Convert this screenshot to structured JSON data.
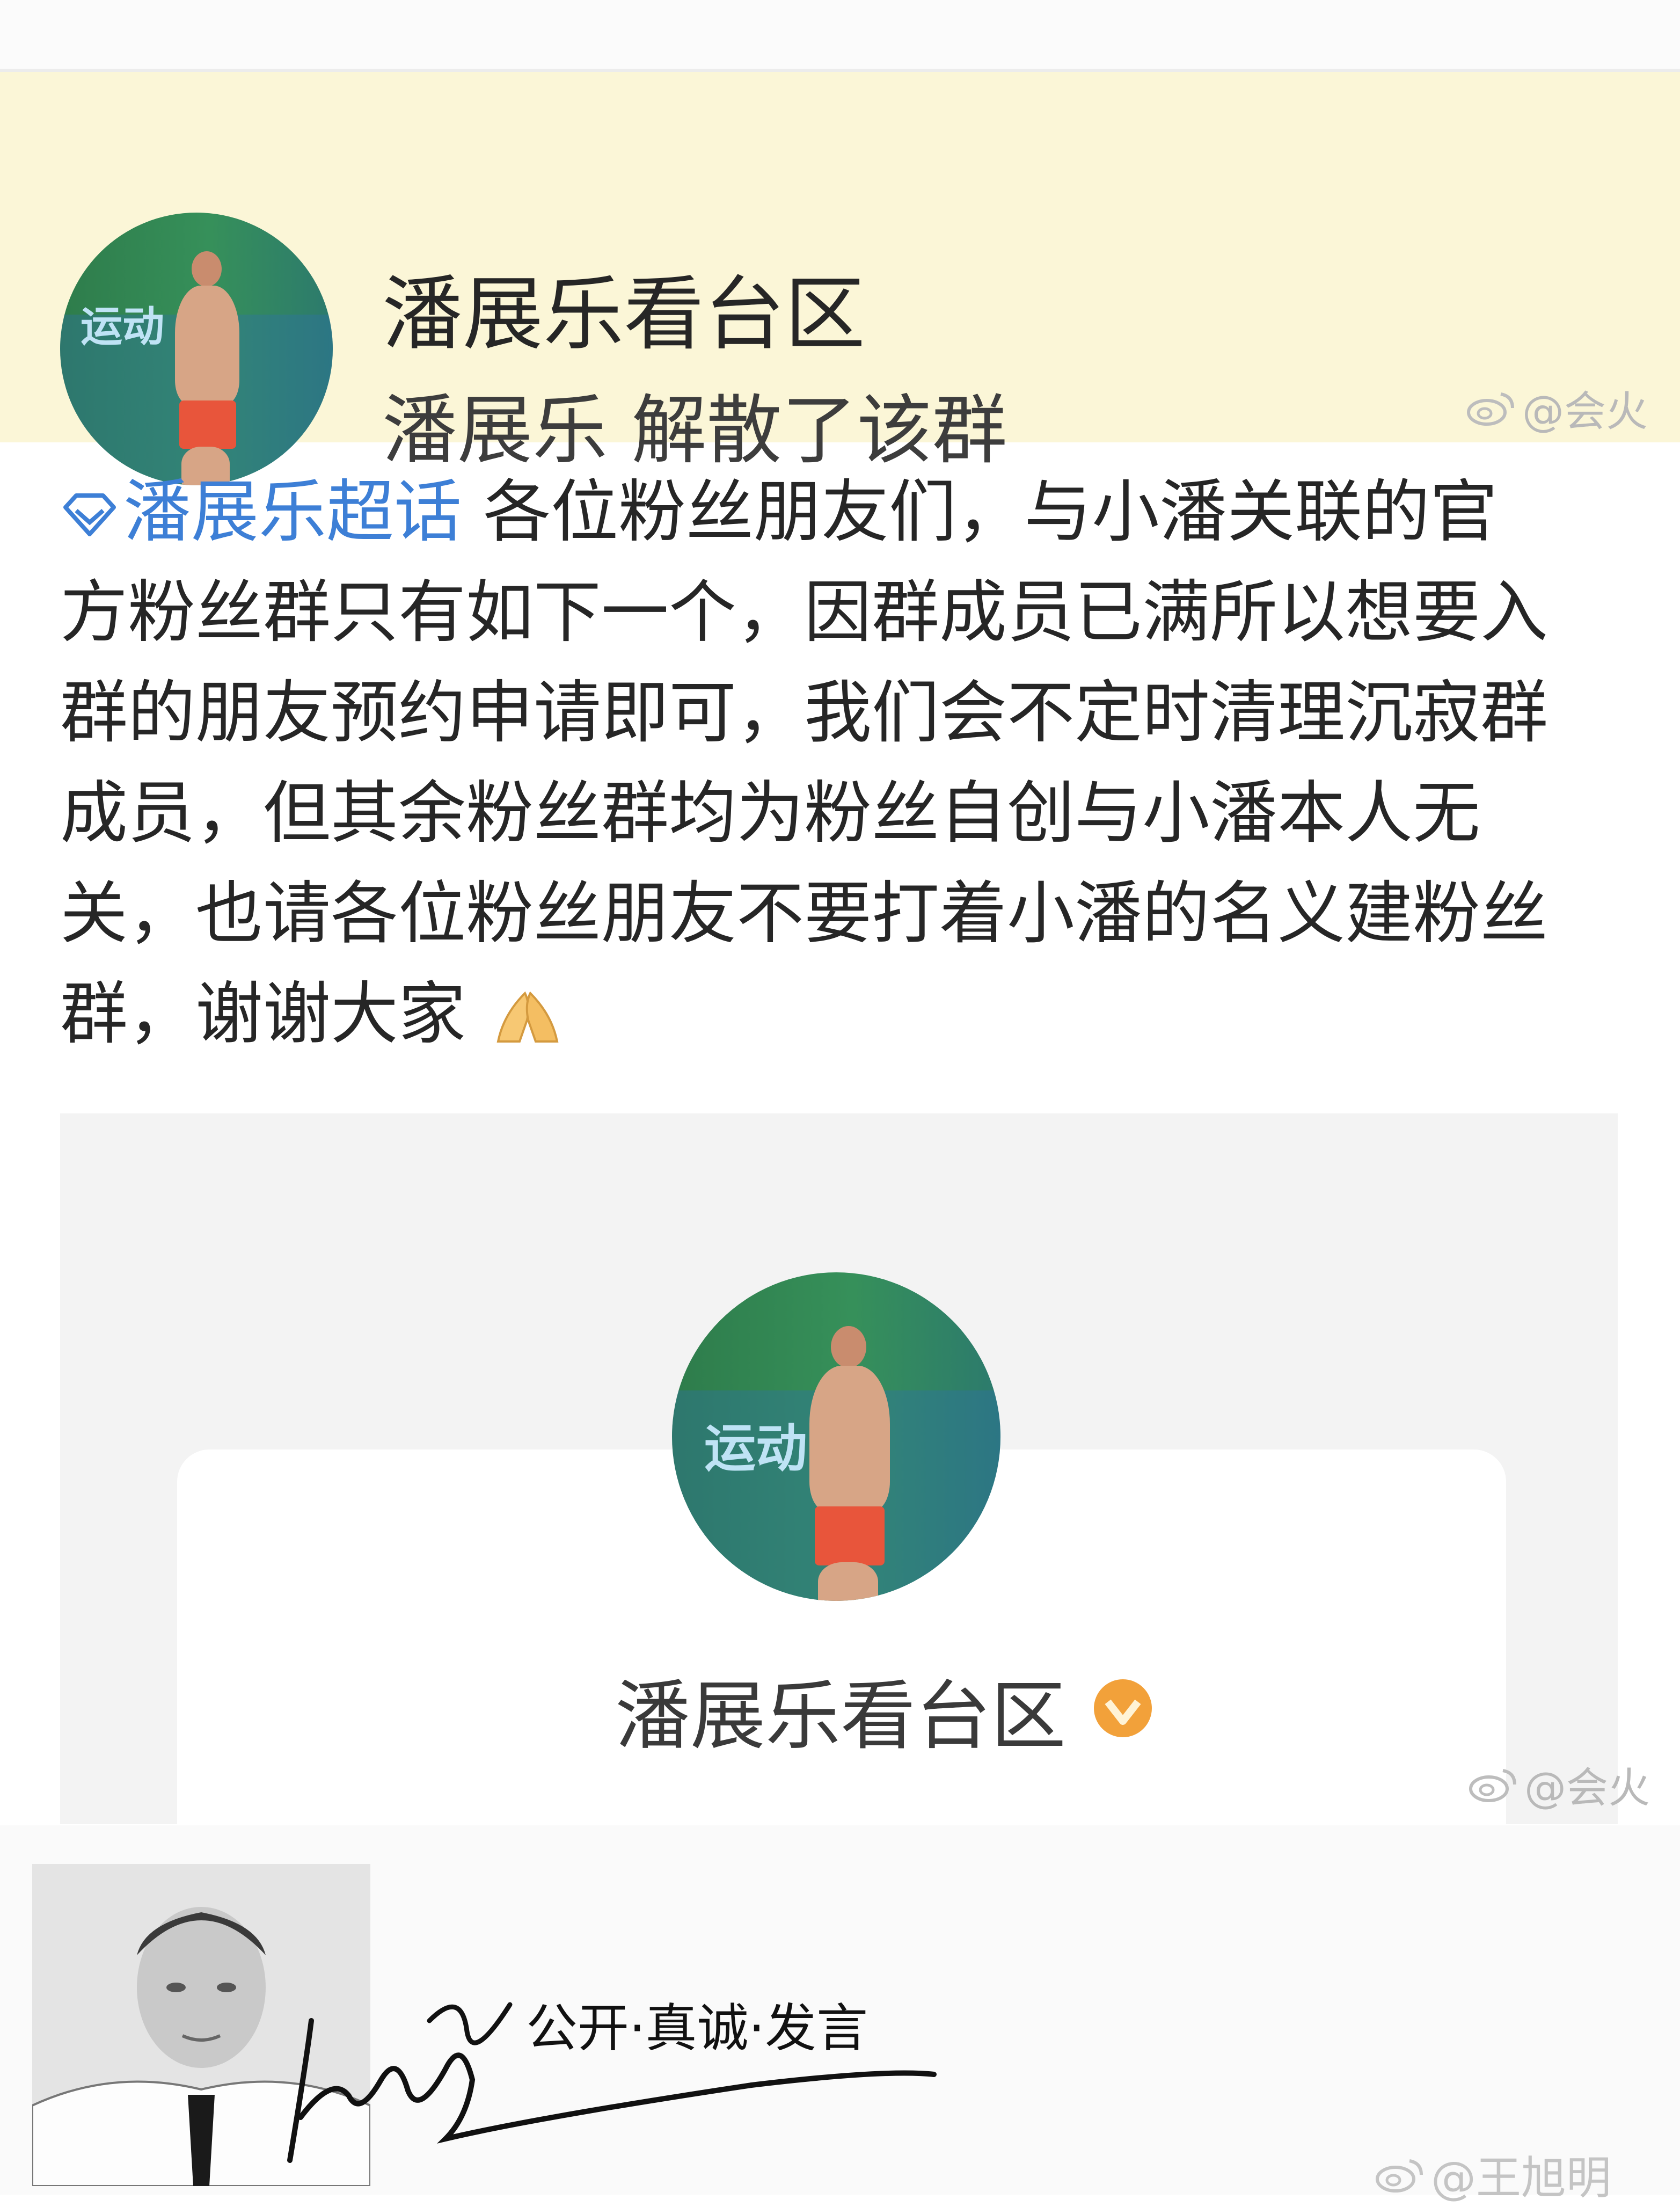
{
  "group_header": {
    "title": "潘展乐看台区",
    "subtitle": "潘展乐 解散了该群",
    "watermark": "@会火"
  },
  "post": {
    "topic": "潘展乐超话",
    "lines": [
      "各位粉丝朋友们，与小潘关联的官",
      "方粉丝群只有如下一个，因群成员已满所以想要入",
      "群的朋友预约申请即可，我们会不定时清理沉寂群",
      "成员，但其余粉丝群均为粉丝自创与小潘本人无",
      "关，也请各位粉丝朋友不要打着小潘的名义建粉丝",
      "群，谢谢大家"
    ]
  },
  "card": {
    "title": "潘展乐看台区",
    "watermark": "@会火"
  },
  "avatar_sign": "运动",
  "footer": {
    "slogan": "公开·真诚·发言",
    "watermark": "@王旭明"
  },
  "colors": {
    "header_bg": "#fbf6d7",
    "topic_blue": "#3d7fd6",
    "badge_orange": "#f2a13a"
  },
  "icons": [
    "topic-diamond-icon",
    "folded-hands-icon",
    "weibo-icon",
    "verified-badge-icon"
  ]
}
